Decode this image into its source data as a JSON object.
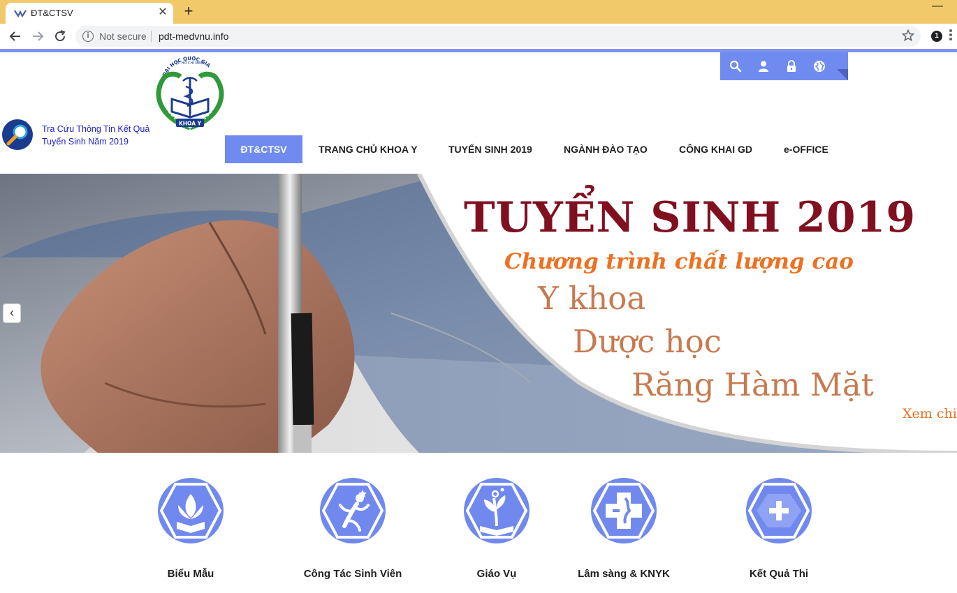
{
  "browser": {
    "tab_title": "ĐT&CTSV",
    "tab_close": "✕",
    "new_tab": "+",
    "minimize": "—",
    "security_label": "Not secure",
    "url": "pdt-medvnu.info",
    "extension_badge": "1"
  },
  "header": {
    "logo_alt": "Khoa Y - Đại học Quốc gia TP. Hồ Chí Minh",
    "lookup_text": "Tra Cứu Thông Tin Kết Quả Tuyển Sinh Năm 2019",
    "util_icons": [
      "search-icon",
      "user-icon",
      "lock-icon",
      "globe-icon"
    ]
  },
  "nav": {
    "items": [
      {
        "label": "ĐT&CTSV",
        "active": true
      },
      {
        "label": "TRANG CHỦ KHOA Y",
        "active": false
      },
      {
        "label": "TUYỂN SINH 2019",
        "active": false
      },
      {
        "label": "NGÀNH ĐÀO TẠO",
        "active": false
      },
      {
        "label": "CÔNG KHAI GD",
        "active": false
      },
      {
        "label": "e-OFFICE",
        "active": false
      }
    ]
  },
  "hero": {
    "title": "TUYỂN SINH 2019",
    "subtitle": "Chương trình chất lượng cao",
    "line1": "Y khoa",
    "line2": "Dược học",
    "line3": "Răng Hàm Mặt",
    "more": "Xem chi",
    "prev": "‹"
  },
  "features": [
    {
      "label": "Biểu Mẫu",
      "icon": "lotus-book-icon"
    },
    {
      "label": "Công Tác Sinh Viên",
      "icon": "student-figure-icon"
    },
    {
      "label": "Giáo Vụ",
      "icon": "plant-book-icon"
    },
    {
      "label": "Lâm sàng & KNYK",
      "icon": "medical-cross-icon"
    },
    {
      "label": "Kết Quả Thi",
      "icon": "plus-icon"
    }
  ],
  "colors": {
    "accent": "#6f8bf0",
    "tab_strip": "#f2c96a",
    "hero_title": "#801020",
    "hero_subtitle": "#ee7020",
    "hero_lines": "#c77a50",
    "lookup_link": "#2020d0"
  }
}
